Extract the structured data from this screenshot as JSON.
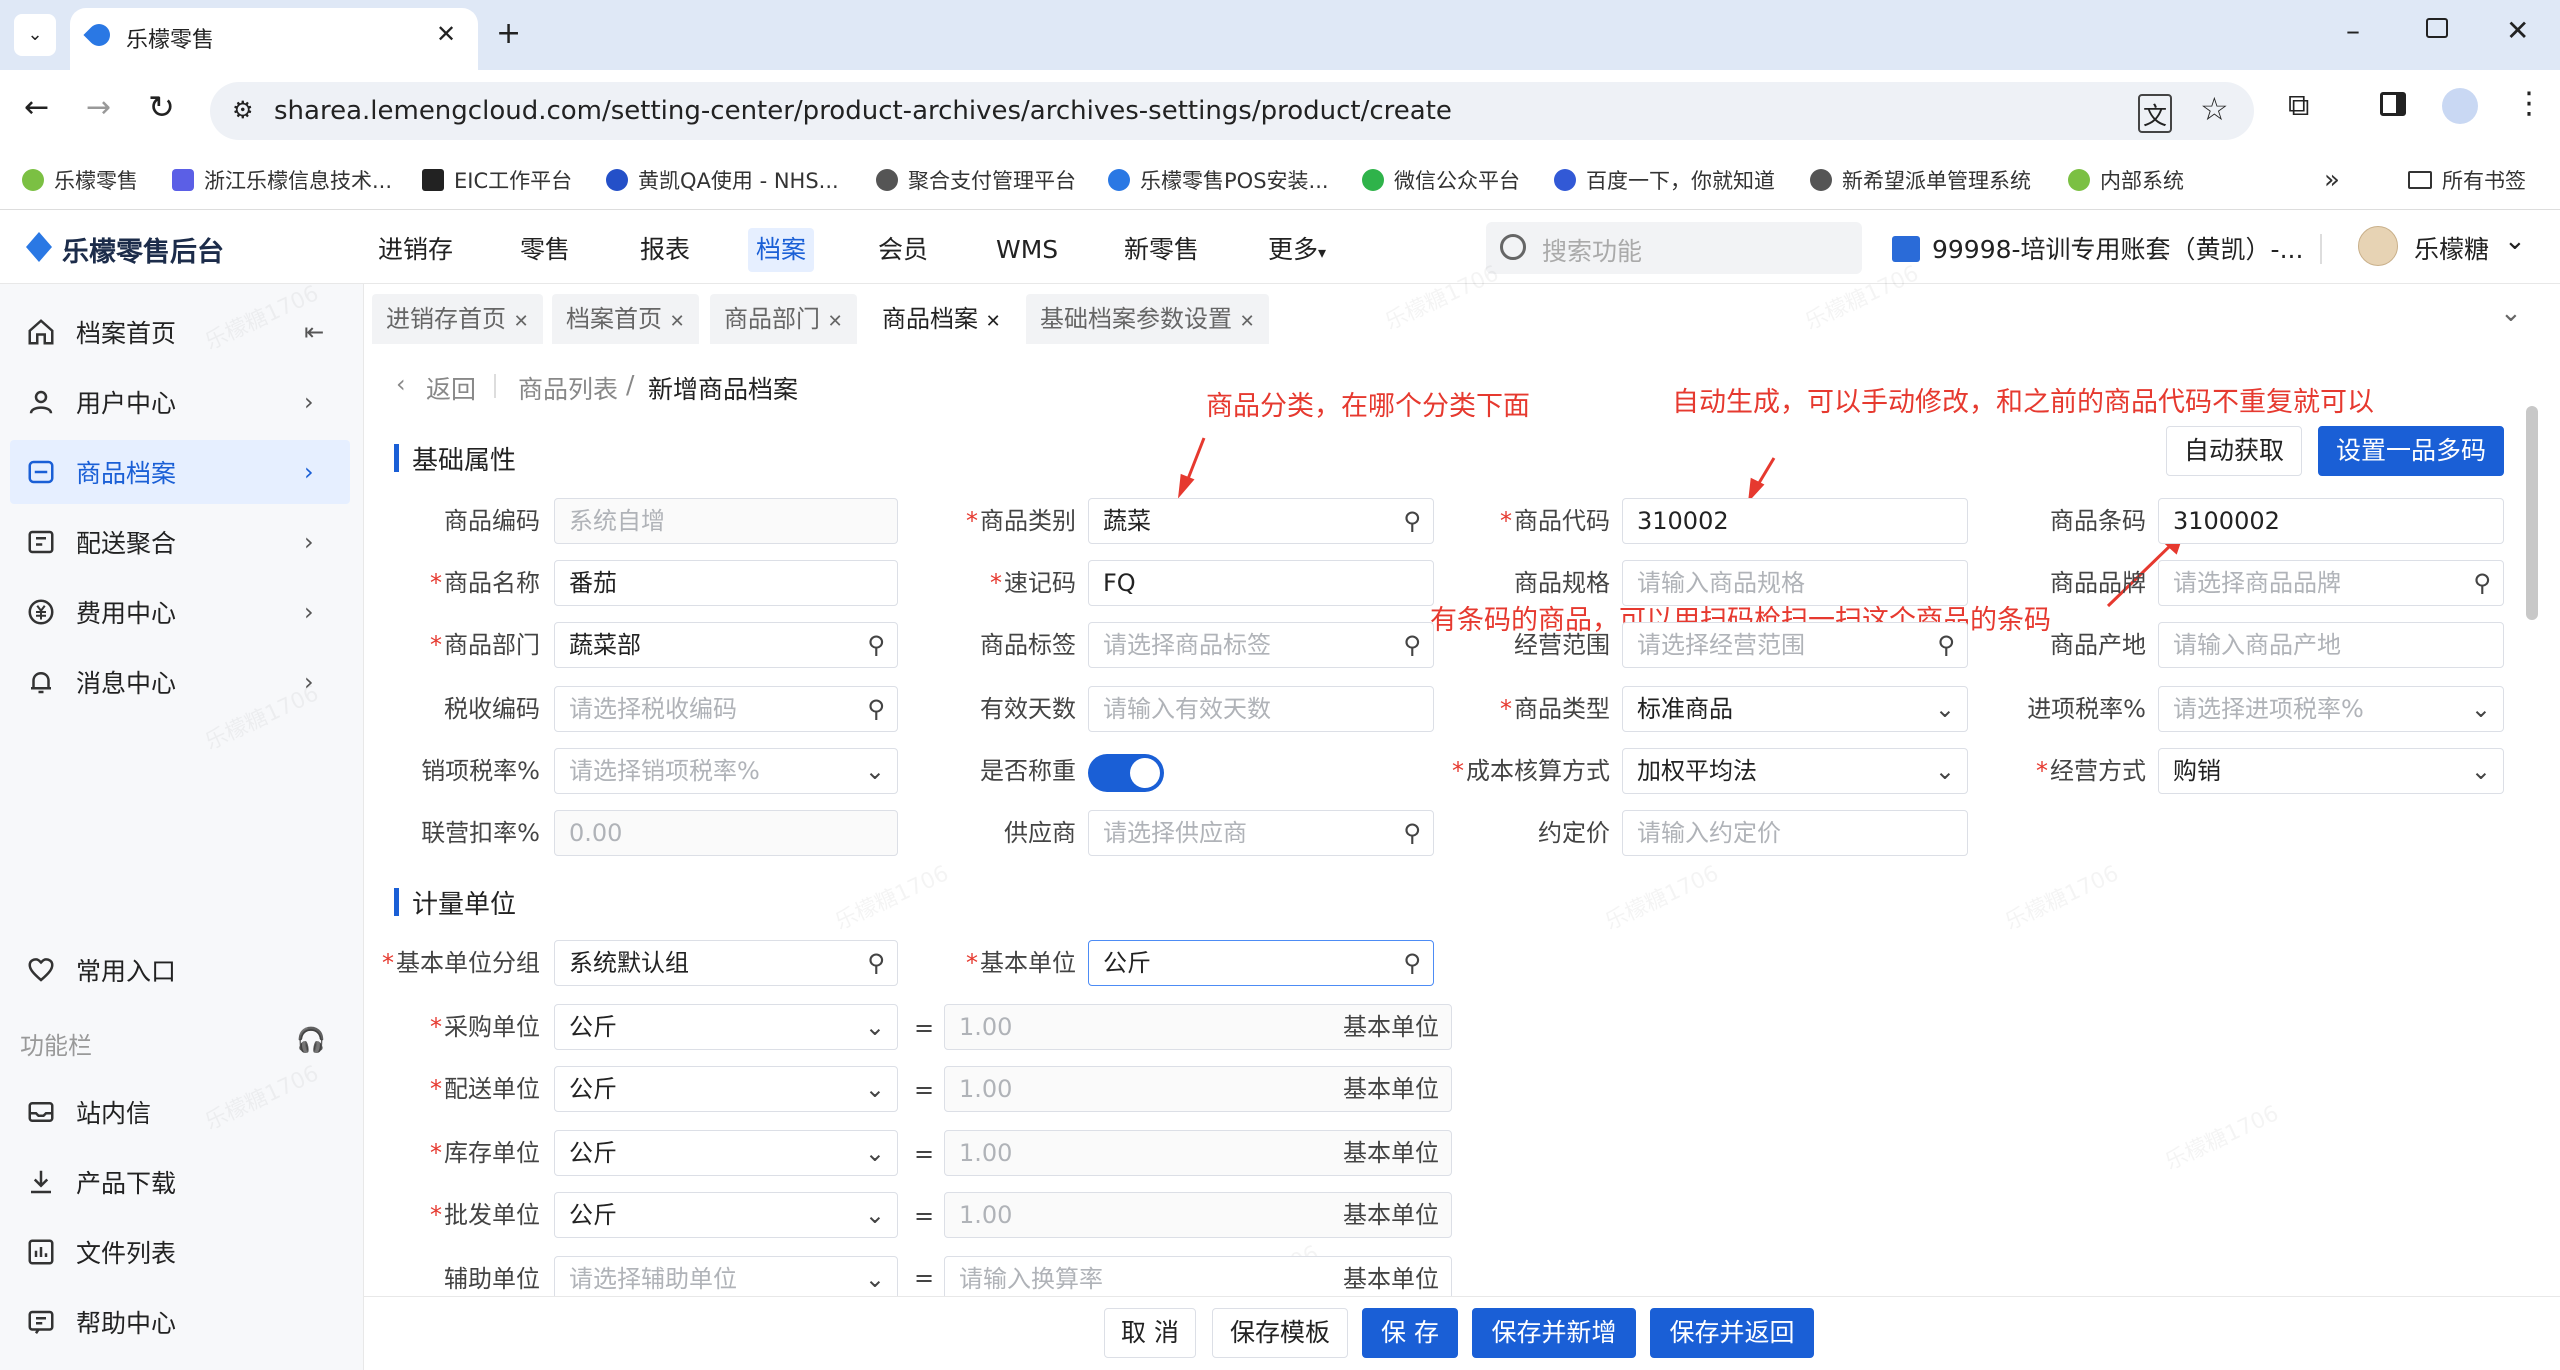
{
  "browser": {
    "tab_title": "乐檬零售",
    "url": "sharea.lemengcloud.com/setting-center/product-archives/archives-settings/product/create",
    "bookmarks": [
      "乐檬零售",
      "浙江乐檬信息技术...",
      "EIC工作平台",
      "黄凯QA使用 - NHS...",
      "聚合支付管理平台",
      "乐檬零售POS安装...",
      "微信公众平台",
      "百度一下，你就知道",
      "新希望派单管理系统",
      "内部系统"
    ],
    "all_bookmarks": "所有书签"
  },
  "app": {
    "logo": "乐檬零售后台",
    "nav": [
      "进销存",
      "零售",
      "报表",
      "档案",
      "会员",
      "WMS",
      "新零售",
      "更多"
    ],
    "active_nav": "档案",
    "search_placeholder": "搜索功能",
    "account": "99998-培训专用账套（黄凯）-...",
    "user": "乐檬糖"
  },
  "sidebar": {
    "items": [
      "档案首页",
      "用户中心",
      "商品档案",
      "配送聚合",
      "费用中心",
      "消息中心"
    ],
    "bottom": [
      "常用入口"
    ],
    "section_label": "功能栏",
    "tools": [
      "站内信",
      "产品下载",
      "文件列表",
      "帮助中心"
    ]
  },
  "page_tabs": [
    "进销存首页",
    "档案首页",
    "商品部门",
    "商品档案",
    "基础档案参数设置"
  ],
  "breadcrumb": {
    "back": "返回",
    "parent": "商品列表",
    "current": "新增商品档案"
  },
  "sections": {
    "basic": "基础属性",
    "unit": "计量单位"
  },
  "buttons": {
    "auto_get": "自动获取",
    "multi_code": "设置一品多码"
  },
  "annotations": {
    "category": "商品分类，在哪个分类下面",
    "code": "自动生成，可以手动修改，和之前的商品代码不重复就可以",
    "barcode": "有条码的商品，可以用扫码枪扫一扫这个商品的条码"
  },
  "form": {
    "code_label": "商品编码",
    "code_ph": "系统自增",
    "category_label": "商品类别",
    "category": "蔬菜",
    "pcode_label": "商品代码",
    "pcode": "310002",
    "barcode_label": "商品条码",
    "barcode": "3100002",
    "name_label": "商品名称",
    "name": "番茄",
    "quick_label": "速记码",
    "quick": "FQ",
    "spec_label": "商品规格",
    "spec_ph": "请输入商品规格",
    "brand_label": "商品品牌",
    "brand_ph": "请选择商品品牌",
    "dept_label": "商品部门",
    "dept": "蔬菜部",
    "tag_label": "商品标签",
    "tag_ph": "请选择商品标签",
    "scope_label": "经营范围",
    "scope_ph": "请选择经营范围",
    "origin_label": "商品产地",
    "origin_ph": "请输入商品产地",
    "tax_label": "税收编码",
    "tax_ph": "请选择税收编码",
    "days_label": "有效天数",
    "days_ph": "请输入有效天数",
    "type_label": "商品类型",
    "type": "标准商品",
    "intax_label": "进项税率%",
    "intax_ph": "请选择进项税率%",
    "outtax_label": "销项税率%",
    "outtax_ph": "请选择销项税率%",
    "weigh_label": "是否称重",
    "cost_label": "成本核算方式",
    "cost": "加权平均法",
    "mode_label": "经营方式",
    "mode": "购销",
    "joint_label": "联营扣率%",
    "joint": "0.00",
    "supplier_label": "供应商",
    "supplier_ph": "请选择供应商",
    "price_label": "约定价",
    "price_ph": "请输入约定价"
  },
  "units": {
    "group_label": "基本单位分组",
    "group": "系统默认组",
    "base_label": "基本单位",
    "base": "公斤",
    "rows": [
      {
        "label": "采购单位",
        "value": "公斤",
        "ratio": "1.00",
        "req": true
      },
      {
        "label": "配送单位",
        "value": "公斤",
        "ratio": "1.00",
        "req": true
      },
      {
        "label": "库存单位",
        "value": "公斤",
        "ratio": "1.00",
        "req": true
      },
      {
        "label": "批发单位",
        "value": "公斤",
        "ratio": "1.00",
        "req": true
      },
      {
        "label": "辅助单位",
        "value": "请选择辅助单位",
        "ratio": "请输入换算率",
        "req": false
      }
    ],
    "suffix": "基本单位"
  },
  "footer": [
    "取 消",
    "保存模板",
    "保 存",
    "保存并新增",
    "保存并返回"
  ],
  "watermark": "乐檬糖1706",
  "colors": {
    "primary": "#1a5fd6",
    "annotation": "#e6392f"
  }
}
